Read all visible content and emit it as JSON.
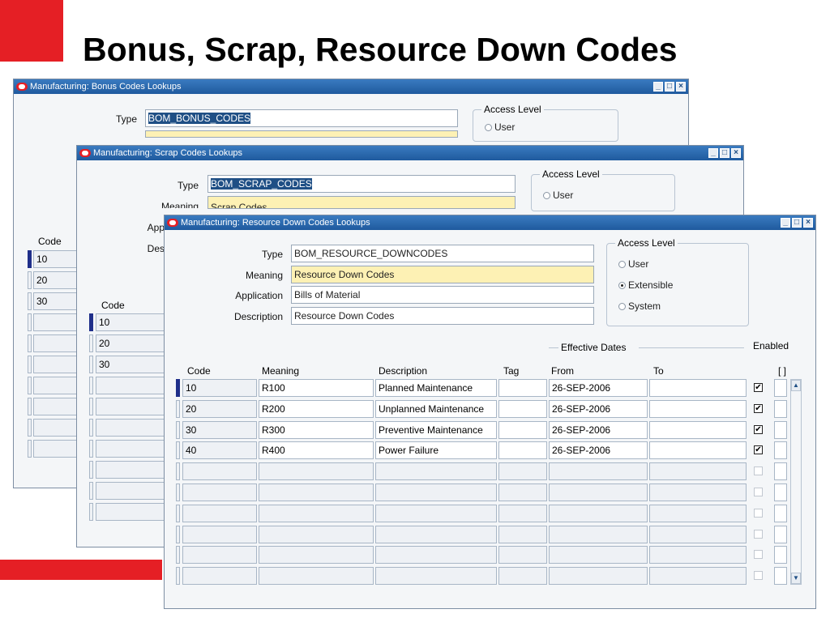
{
  "slide": {
    "title": "Bonus, Scrap, Resource Down Codes",
    "accent_color": "#e51f25"
  },
  "bonus_window": {
    "title": "Manufacturing: Bonus Codes Lookups",
    "type_label": "Type",
    "type_value": "BOM_BONUS_CODES",
    "access_level_label": "Access Level",
    "user_label": "User",
    "code_header": "Code",
    "codes": [
      "10",
      "20",
      "30"
    ]
  },
  "scrap_window": {
    "title": "Manufacturing: Scrap Codes Lookups",
    "type_label": "Type",
    "type_value": "BOM_SCRAP_CODES",
    "meaning_label": "Meaning",
    "meaning_value": "Scrap Codes",
    "application_label": "App",
    "description_label": "Des",
    "access_level_label": "Access Level",
    "user_label": "User",
    "code_header": "Code",
    "codes": [
      "10",
      "20",
      "30"
    ]
  },
  "resource_window": {
    "title": "Manufacturing: Resource Down Codes Lookups",
    "type_label": "Type",
    "type_value": "BOM_RESOURCE_DOWNCODES",
    "meaning_label": "Meaning",
    "meaning_value": "Resource Down Codes",
    "application_label": "Application",
    "application_value": "Bills of Material",
    "description_label": "Description",
    "description_value": "Resource Down Codes",
    "access_level": {
      "label": "Access Level",
      "options": [
        "User",
        "Extensible",
        "System"
      ],
      "selected": "Extensible"
    },
    "effective_dates_label": "Effective Dates",
    "enabled_label": "Enabled",
    "flex_label": "[ ]",
    "columns": [
      "Code",
      "Meaning",
      "Description",
      "Tag",
      "From",
      "To"
    ],
    "rows": [
      {
        "code": "10",
        "meaning": "R100",
        "description": "Planned Maintenance",
        "tag": "",
        "from": "26-SEP-2006",
        "to": "",
        "enabled": true
      },
      {
        "code": "20",
        "meaning": "R200",
        "description": "Unplanned Maintenance",
        "tag": "",
        "from": "26-SEP-2006",
        "to": "",
        "enabled": true
      },
      {
        "code": "30",
        "meaning": "R300",
        "description": "Preventive Maintenance",
        "tag": "",
        "from": "26-SEP-2006",
        "to": "",
        "enabled": true
      },
      {
        "code": "40",
        "meaning": "R400",
        "description": "Power Failure",
        "tag": "",
        "from": "26-SEP-2006",
        "to": "",
        "enabled": true
      },
      {
        "code": "",
        "meaning": "",
        "description": "",
        "tag": "",
        "from": "",
        "to": "",
        "enabled": false
      },
      {
        "code": "",
        "meaning": "",
        "description": "",
        "tag": "",
        "from": "",
        "to": "",
        "enabled": false
      },
      {
        "code": "",
        "meaning": "",
        "description": "",
        "tag": "",
        "from": "",
        "to": "",
        "enabled": false
      },
      {
        "code": "",
        "meaning": "",
        "description": "",
        "tag": "",
        "from": "",
        "to": "",
        "enabled": false
      },
      {
        "code": "",
        "meaning": "",
        "description": "",
        "tag": "",
        "from": "",
        "to": "",
        "enabled": false
      },
      {
        "code": "",
        "meaning": "",
        "description": "",
        "tag": "",
        "from": "",
        "to": "",
        "enabled": false
      }
    ]
  }
}
